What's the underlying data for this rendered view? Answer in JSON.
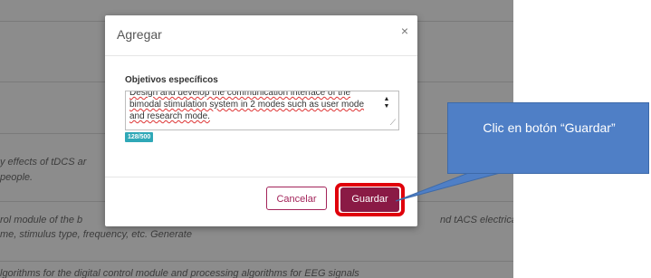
{
  "background": {
    "lines": [
      "y effects of tDCS ar",
      "people.",
      "rol module of the b",
      "me, stimulus type, frequency, etc. Generate",
      "nd tACS electrica",
      "lgorithms for the digital control module and processing algorithms for EEG signals"
    ]
  },
  "modal": {
    "title": "Agregar",
    "close_icon": "×",
    "field_label": "Objetivos específicos",
    "textarea_value": "Design and develop the communication interface of the bimodal stimulation system in 2 modes such as user mode and research mode.",
    "counter": "128/500",
    "cancel_label": "Cancelar",
    "save_label": "Guardar"
  },
  "callout": {
    "text": "Clic en botón “Guardar”"
  },
  "colors": {
    "accent": "#8a1a45",
    "highlight": "#e0000b",
    "callout": "#4f7fc6",
    "counter": "#2fa8b7"
  }
}
